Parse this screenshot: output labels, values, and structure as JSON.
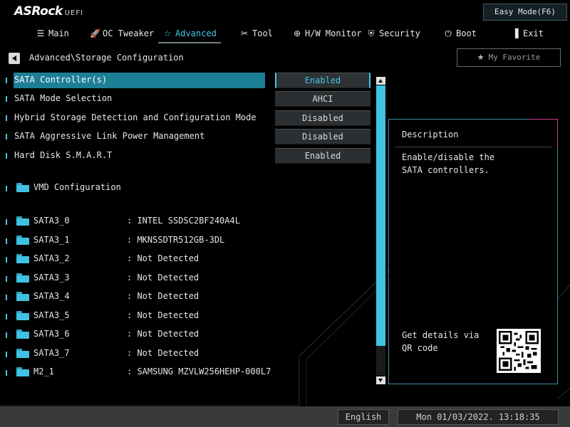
{
  "header": {
    "logo_text": "ASRock",
    "logo_sub": "UEFI",
    "easy_mode_label": "Easy Mode(F6)"
  },
  "tabs": [
    {
      "label": "Main",
      "icon": "list-icon",
      "active": false
    },
    {
      "label": "OC Tweaker",
      "icon": "rocket-icon",
      "active": false
    },
    {
      "label": "Advanced",
      "icon": "star-icon",
      "active": true
    },
    {
      "label": "Tool",
      "icon": "tools-icon",
      "active": false
    },
    {
      "label": "H/W Monitor",
      "icon": "monitor-gauge-icon",
      "active": false
    },
    {
      "label": "Security",
      "icon": "shield-icon",
      "active": false
    },
    {
      "label": "Boot",
      "icon": "power-icon",
      "active": false
    },
    {
      "label": "Exit",
      "icon": "exit-door-icon",
      "active": false
    }
  ],
  "breadcrumb": "Advanced\\Storage Configuration",
  "favorite_label": "My Favorite",
  "settings": [
    {
      "label": "SATA Controller(s)",
      "value": "Enabled",
      "selected": true
    },
    {
      "label": "SATA Mode Selection",
      "value": "AHCI",
      "selected": false
    },
    {
      "label": "Hybrid Storage Detection and Configuration Mode",
      "value": "Disabled",
      "selected": false
    },
    {
      "label": "SATA Aggressive Link Power Management",
      "value": "Disabled",
      "selected": false
    },
    {
      "label": "Hard Disk S.M.A.R.T",
      "value": "Enabled",
      "selected": false
    }
  ],
  "vmd_label": "VMD Configuration",
  "devices": [
    {
      "name": "SATA3_0",
      "value": ": INTEL SSDSC2BF240A4L"
    },
    {
      "name": "SATA3_1",
      "value": ": MKNSSDTR512GB-3DL"
    },
    {
      "name": "SATA3_2",
      "value": ": Not Detected"
    },
    {
      "name": "SATA3_3",
      "value": ": Not Detected"
    },
    {
      "name": "SATA3_4",
      "value": ": Not Detected"
    },
    {
      "name": "SATA3_5",
      "value": ": Not Detected"
    },
    {
      "name": "SATA3_6",
      "value": ": Not Detected"
    },
    {
      "name": "SATA3_7",
      "value": ": Not Detected"
    },
    {
      "name": "M2_1",
      "value": ": SAMSUNG MZVLW256HEHP-000L7"
    }
  ],
  "description": {
    "title": "Description",
    "text": "Enable/disable the SATA controllers.",
    "qr_text": "Get details via QR code"
  },
  "footer": {
    "language": "English",
    "datetime": "Mon 01/03/2022. 13:18:35"
  },
  "colors": {
    "accent": "#45c8e6",
    "selection": "#1d7f96",
    "desc_border": "#3d8ea8",
    "desc_corner": "#d23c8a"
  }
}
